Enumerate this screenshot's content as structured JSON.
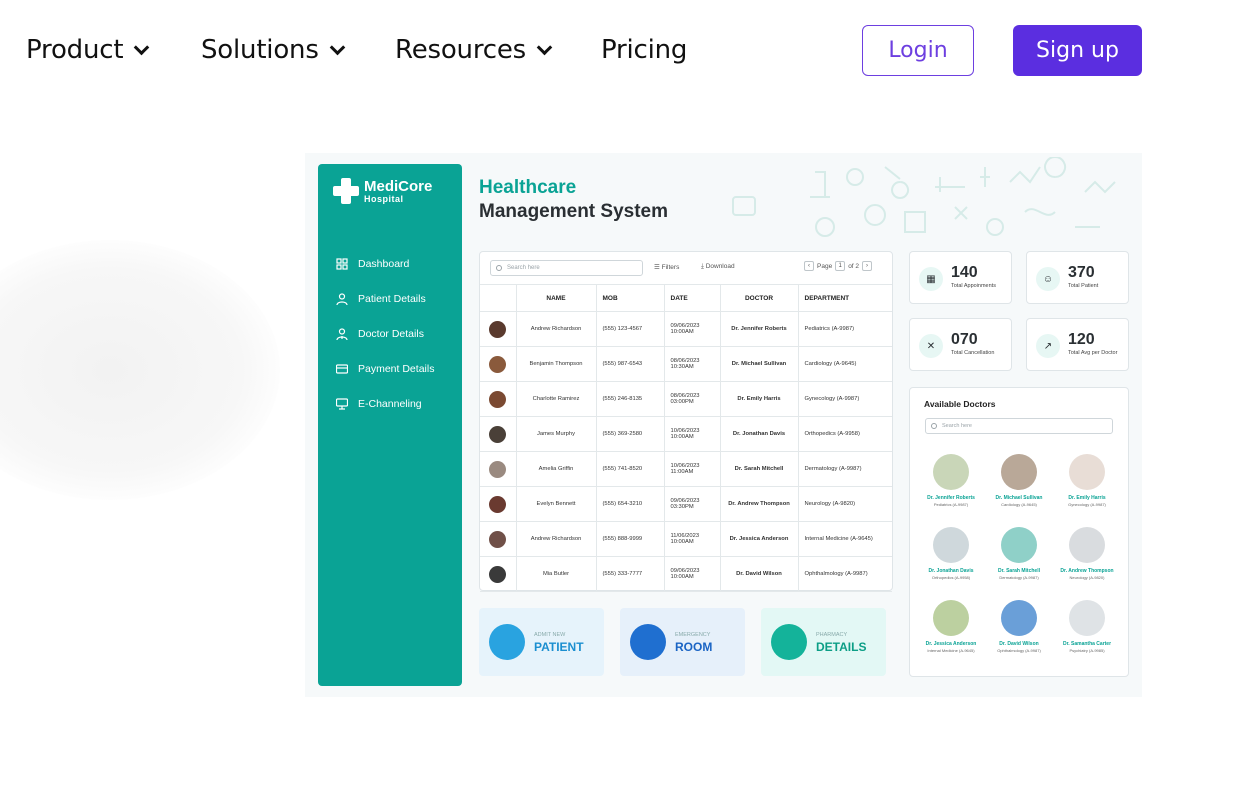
{
  "nav": {
    "items": [
      {
        "label": "Product",
        "has_dropdown": true
      },
      {
        "label": "Solutions",
        "has_dropdown": true
      },
      {
        "label": "Resources",
        "has_dropdown": true
      },
      {
        "label": "Pricing",
        "has_dropdown": false
      }
    ],
    "login_label": "Login",
    "signup_label": "Sign up",
    "accent_color": "#5b2ee0"
  },
  "mockup": {
    "brand": {
      "name": "MediCore",
      "sub": "Hospital",
      "color": "#0aa395"
    },
    "sidebar": [
      {
        "label": "Dashboard",
        "icon": "grid-icon"
      },
      {
        "label": "Patient Details",
        "icon": "patient-icon"
      },
      {
        "label": "Doctor Details",
        "icon": "doctor-icon"
      },
      {
        "label": "Payment Details",
        "icon": "card-icon"
      },
      {
        "label": "E-Channeling",
        "icon": "channel-icon"
      }
    ],
    "title_line1": "Healthcare",
    "title_line2": "Management System",
    "table": {
      "search_placeholder": "Search here",
      "filters_label": "Filters",
      "download_label": "Download",
      "page_label": "Page",
      "page_current": "1",
      "page_of": "of 2",
      "columns": [
        "",
        "NAME",
        "MOB",
        "DATE",
        "DOCTOR",
        "DEPARTMENT"
      ],
      "rows": [
        {
          "name": "Andrew Richardson",
          "mob": "(555) 123-4567",
          "date": "09/06/2023",
          "time": "10:00AM",
          "doctor": "Dr. Jennifer Roberts",
          "dept": "Pediatrics (A-9987)"
        },
        {
          "name": "Benjamin Thompson",
          "mob": "(555) 987-6543",
          "date": "08/06/2023",
          "time": "10:30AM",
          "doctor": "Dr. Michael Sullivan",
          "dept": "Cardiology (A-9645)"
        },
        {
          "name": "Charlotte Ramirez",
          "mob": "(555) 246-8135",
          "date": "08/06/2023",
          "time": "03:00PM",
          "doctor": "Dr. Emily Harris",
          "dept": "Gynecology (A-9987)"
        },
        {
          "name": "James Murphy",
          "mob": "(555) 369-2580",
          "date": "10/06/2023",
          "time": "10:00AM",
          "doctor": "Dr. Jonathan Davis",
          "dept": "Orthopedics (A-9958)"
        },
        {
          "name": "Amelia Griffin",
          "mob": "(555) 741-8520",
          "date": "10/06/2023",
          "time": "11:00AM",
          "doctor": "Dr. Sarah Mitchell",
          "dept": "Dermatology (A-9987)"
        },
        {
          "name": "Evelyn Bennett",
          "mob": "(555) 654-3210",
          "date": "09/06/2023",
          "time": "03:30PM",
          "doctor": "Dr. Andrew Thompson",
          "dept": "Neurology (A-9820)"
        },
        {
          "name": "Andrew Richardson",
          "mob": "(555) 888-9999",
          "date": "11/06/2023",
          "time": "10:00AM",
          "doctor": "Dr. Jessica Anderson",
          "dept": "Internal Medicine (A-9645)"
        },
        {
          "name": "Mia Butler",
          "mob": "(555) 333-7777",
          "date": "09/06/2023",
          "time": "10:00AM",
          "doctor": "Dr. David Wilson",
          "dept": "Ophthalmology (A-9987)"
        }
      ]
    },
    "tiles": [
      {
        "small": "ADMIT NEW",
        "big": "PATIENT",
        "bg": "#e6f3fb",
        "circle": "#29a3e0",
        "color": "#1b8fd0",
        "icon": "patient-add-icon"
      },
      {
        "small": "EMERGENCY",
        "big": "ROOM",
        "bg": "#e6f0fa",
        "circle": "#1f6fd0",
        "color": "#1a64c4",
        "icon": "ambulance-icon"
      },
      {
        "small": "PHARMACY",
        "big": "DETAILS",
        "bg": "#e3f8f5",
        "circle": "#14b39a",
        "color": "#0c9e86",
        "icon": "pill-bottle-icon"
      }
    ],
    "stats": [
      {
        "value": "140",
        "label": "Total Appoinments",
        "icon": "calendar-icon",
        "glyph": "▦"
      },
      {
        "value": "370",
        "label": "Total Patient",
        "icon": "patient-icon",
        "glyph": "☺"
      },
      {
        "value": "070",
        "label": "Total Cancellation",
        "icon": "cancel-icon",
        "glyph": "✕"
      },
      {
        "value": "120",
        "label": "Total Avg per Doctor",
        "icon": "chart-icon",
        "glyph": "↗"
      }
    ],
    "doctors_title": "Available Doctors",
    "doctors_search": "Search here",
    "doctors": [
      {
        "name": "Dr. Jennifer Roberts",
        "spec": "Pediatrics (A-9987)"
      },
      {
        "name": "Dr. Michael Sullivan",
        "spec": "Cardiology (A-9645)"
      },
      {
        "name": "Dr. Emily Harris",
        "spec": "Gynecology (A-9987)"
      },
      {
        "name": "Dr. Jonathan Davis",
        "spec": "Orthopedics (A-9958)"
      },
      {
        "name": "Dr. Sarah Mitchell",
        "spec": "Dermatology (A-9987)"
      },
      {
        "name": "Dr. Andrew Thompson",
        "spec": "Neurology (A-9820)"
      },
      {
        "name": "Dr. Jessica Anderson",
        "spec": "Internal Medicine (A-9645)"
      },
      {
        "name": "Dr. David Wilson",
        "spec": "Ophthalmology (A-9987)"
      },
      {
        "name": "Dr. Samantha Carter",
        "spec": "Psychiatry (A-9985)"
      }
    ]
  }
}
